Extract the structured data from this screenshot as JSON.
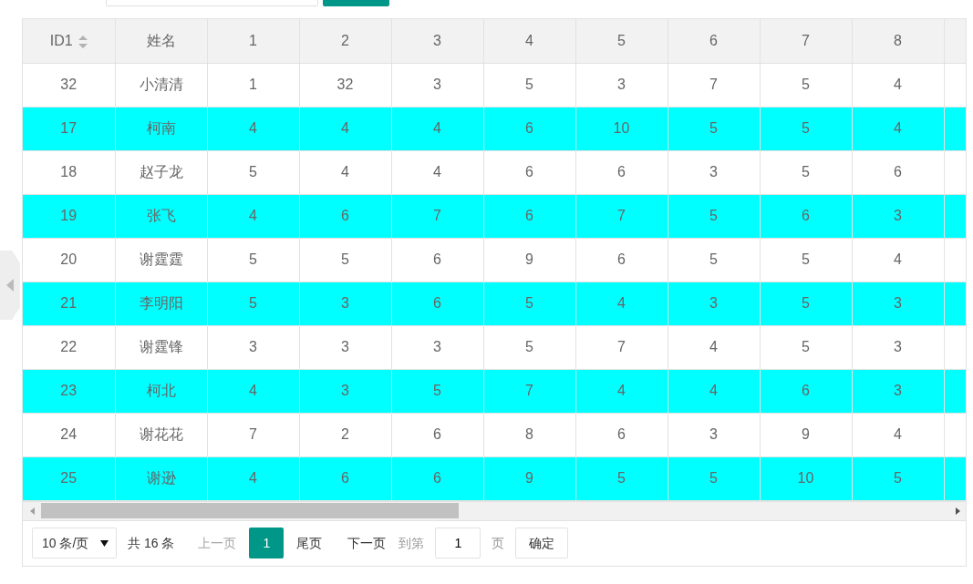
{
  "table": {
    "columns": [
      {
        "label": "ID1",
        "sortable": true
      },
      {
        "label": "姓名",
        "sortable": false
      },
      {
        "label": "1",
        "sortable": false
      },
      {
        "label": "2",
        "sortable": false
      },
      {
        "label": "3",
        "sortable": false
      },
      {
        "label": "4",
        "sortable": false
      },
      {
        "label": "5",
        "sortable": false
      },
      {
        "label": "6",
        "sortable": false
      },
      {
        "label": "7",
        "sortable": false
      },
      {
        "label": "8",
        "sortable": false
      }
    ],
    "rows": [
      {
        "cells": [
          "32",
          "小清清",
          "1",
          "32",
          "3",
          "5",
          "3",
          "7",
          "5",
          "4"
        ],
        "highlighted": false
      },
      {
        "cells": [
          "17",
          "柯南",
          "4",
          "4",
          "4",
          "6",
          "10",
          "5",
          "5",
          "4"
        ],
        "highlighted": true
      },
      {
        "cells": [
          "18",
          "赵子龙",
          "5",
          "4",
          "4",
          "6",
          "6",
          "3",
          "5",
          "6"
        ],
        "highlighted": false
      },
      {
        "cells": [
          "19",
          "张飞",
          "4",
          "6",
          "7",
          "6",
          "7",
          "5",
          "6",
          "3"
        ],
        "highlighted": true
      },
      {
        "cells": [
          "20",
          "谢霆霆",
          "5",
          "5",
          "6",
          "9",
          "6",
          "5",
          "5",
          "4"
        ],
        "highlighted": false
      },
      {
        "cells": [
          "21",
          "李明阳",
          "5",
          "3",
          "6",
          "5",
          "4",
          "3",
          "5",
          "3"
        ],
        "highlighted": true
      },
      {
        "cells": [
          "22",
          "谢霆锋",
          "3",
          "3",
          "3",
          "5",
          "7",
          "4",
          "5",
          "3"
        ],
        "highlighted": false
      },
      {
        "cells": [
          "23",
          "柯北",
          "4",
          "3",
          "5",
          "7",
          "4",
          "4",
          "6",
          "3"
        ],
        "highlighted": true
      },
      {
        "cells": [
          "24",
          "谢花花",
          "7",
          "2",
          "6",
          "8",
          "6",
          "3",
          "9",
          "4"
        ],
        "highlighted": false
      },
      {
        "cells": [
          "25",
          "谢逊",
          "4",
          "6",
          "6",
          "9",
          "5",
          "5",
          "10",
          "5"
        ],
        "highlighted": true
      }
    ]
  },
  "pagination": {
    "page_size": "10 条/页",
    "total": "共 16 条",
    "prev": {
      "label": "上一页",
      "disabled": true
    },
    "pages": [
      {
        "label": "1",
        "selected": true
      }
    ],
    "last": "尾页",
    "next": {
      "label": "下一页",
      "disabled": false
    },
    "goto_label": "到第",
    "goto_value": "1",
    "page_unit": "页",
    "confirm": "确定"
  }
}
